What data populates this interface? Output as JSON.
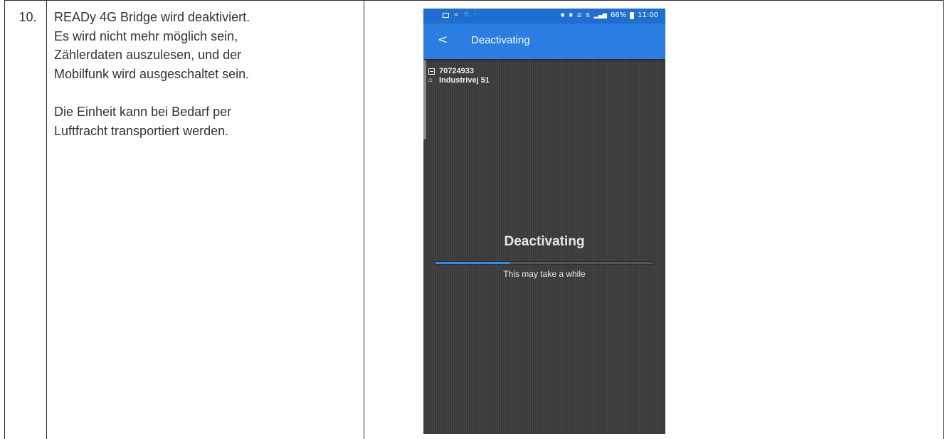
{
  "step": {
    "number": "10.",
    "paragraphs": [
      "READy 4G Bridge wird deaktiviert.\nEs wird nicht mehr möglich sein,\nZählerdaten auszulesen, und der\nMobilfunk wird ausgeschaltet sein.",
      "Die Einheit kann bei Bedarf per\nLuftfracht transportiert werden."
    ]
  },
  "phone": {
    "status_bar": {
      "left_icons": [
        "image-icon",
        "wifi-calling-icon",
        "heart-icon",
        "dot-icon"
      ],
      "right_icons": [
        "bluetooth-icon",
        "mute-icon",
        "volte-icon",
        "4g-icon",
        "signal-icon"
      ],
      "battery_text": "66%",
      "time": "11:00"
    },
    "app_bar": {
      "back_glyph": "<",
      "title": "Deactivating"
    },
    "meter_id": "70724933",
    "address": "Industrivej 51",
    "main_title": "Deactivating",
    "progress_fraction": 0.34,
    "progress_text": "This may take a while",
    "colors": {
      "status_bar": "#1f6fd0",
      "app_bar": "#2a7de1",
      "progress_fill": "#2a8ff0",
      "background": "#404040"
    }
  }
}
